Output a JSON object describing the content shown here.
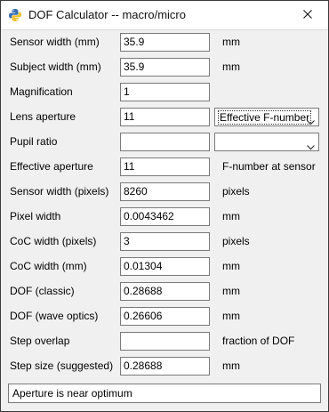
{
  "window": {
    "title": "DOF Calculator -- macro/micro",
    "icon": "python-icon",
    "close_icon": "close-icon"
  },
  "fields": [
    {
      "label": "Sensor width (mm)",
      "value": "35.9",
      "unit": "mm"
    },
    {
      "label": "Subject width (mm)",
      "value": "35.9",
      "unit": "mm"
    },
    {
      "label": "Magnification",
      "value": "1",
      "unit": ""
    },
    {
      "label": "Lens aperture",
      "value": "11",
      "select": "Effective F-number"
    },
    {
      "label": "Pupil ratio",
      "value": "",
      "select": ""
    },
    {
      "label": "Effective aperture",
      "value": "11",
      "unit": "F-number at sensor"
    },
    {
      "label": "Sensor width (pixels)",
      "value": "8260",
      "unit": "pixels"
    },
    {
      "label": "Pixel width",
      "value": "0.0043462",
      "unit": "mm"
    },
    {
      "label": "CoC width (pixels)",
      "value": "3",
      "unit": "pixels"
    },
    {
      "label": "CoC width (mm)",
      "value": "0.01304",
      "unit": "mm"
    },
    {
      "label": "DOF (classic)",
      "value": "0.28688",
      "unit": "mm"
    },
    {
      "label": "DOF (wave optics)",
      "value": "0.26606",
      "unit": "mm"
    },
    {
      "label": "Step overlap",
      "value": "",
      "unit": "fraction of DOF"
    },
    {
      "label": "Step size (suggested)",
      "value": "0.28688",
      "unit": "mm"
    }
  ],
  "status": "Aperture is near optimum"
}
